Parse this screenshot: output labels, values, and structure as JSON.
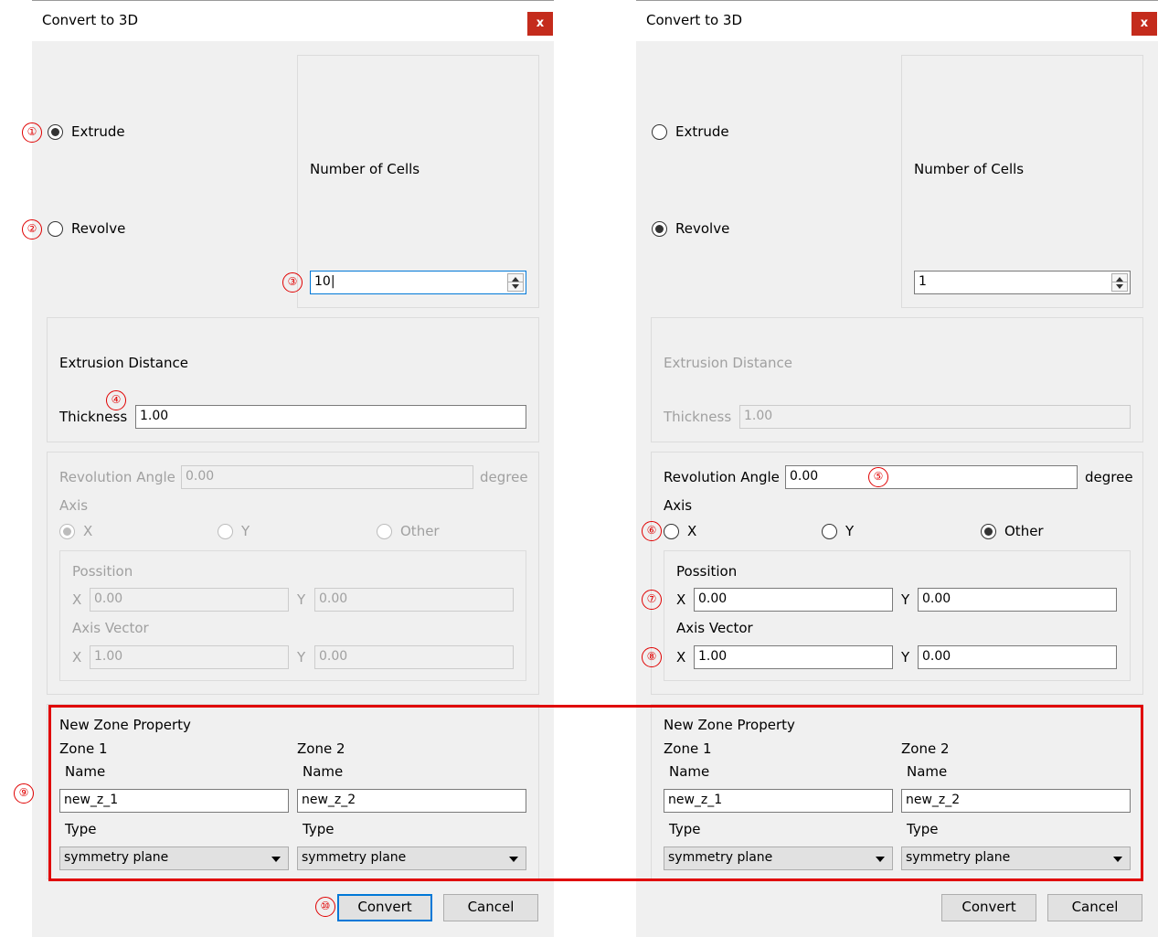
{
  "dialog_title": "Convert to 3D",
  "close_glyph": "x",
  "labels": {
    "extrude": "Extrude",
    "revolve": "Revolve",
    "number_of_cells": "Number of Cells",
    "extrusion_distance": "Extrusion Distance",
    "thickness": "Thickness",
    "revolution_angle": "Revolution Angle",
    "degree": "degree",
    "axis": "Axis",
    "axis_x": "X",
    "axis_y": "Y",
    "axis_other": "Other",
    "possition": "Possition",
    "axis_vector": "Axis Vector",
    "x": "X",
    "y": "Y",
    "new_zone_property": "New Zone Property",
    "zone1": "Zone 1",
    "zone2": "Zone 2",
    "name": "Name",
    "type": "Type",
    "convert": "Convert",
    "cancel": "Cancel"
  },
  "markers": [
    "①",
    "②",
    "③",
    "④",
    "⑤",
    "⑥",
    "⑦",
    "⑧",
    "⑨",
    "⑩"
  ],
  "left": {
    "mode": "extrude",
    "number_of_cells": "10",
    "thickness": "1.00",
    "revolution_angle": "0.00",
    "axis_selected": "X",
    "pos_x": "0.00",
    "pos_y": "0.00",
    "vec_x": "1.00",
    "vec_y": "0.00",
    "zone1_name": "new_z_1",
    "zone2_name": "new_z_2",
    "zone1_type": "symmetry plane",
    "zone2_type": "symmetry plane"
  },
  "right": {
    "mode": "revolve",
    "number_of_cells": "1",
    "thickness": "1.00",
    "revolution_angle": "0.00",
    "axis_selected": "Other",
    "pos_x": "0.00",
    "pos_y": "0.00",
    "vec_x": "1.00",
    "vec_y": "0.00",
    "zone1_name": "new_z_1",
    "zone2_name": "new_z_2",
    "zone1_type": "symmetry plane",
    "zone2_type": "symmetry plane"
  },
  "colors": {
    "highlight": "#e00000",
    "focus": "#0078d7",
    "close": "#c42b1c"
  }
}
